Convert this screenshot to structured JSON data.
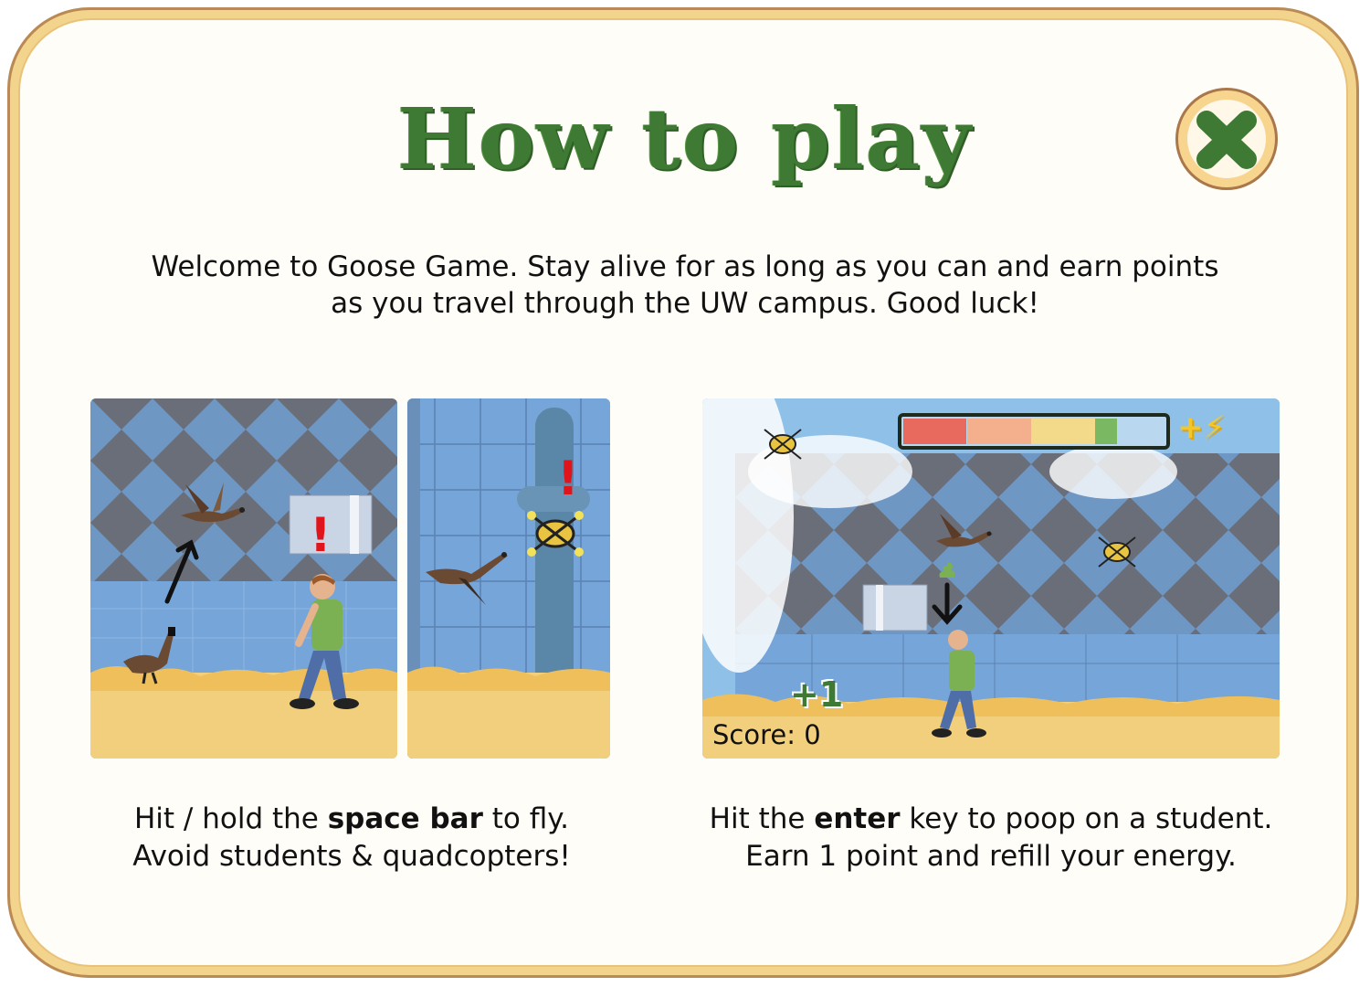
{
  "title": "How to play",
  "close_icon": "x-icon",
  "intro": {
    "line1": "Welcome to Goose Game. Stay alive for as long as you can and earn points",
    "line2": "as you travel through the UW campus. Good luck!"
  },
  "scene_fly": {
    "exclaim": "!",
    "caption": {
      "line1_pre": "Hit / hold the ",
      "line1_bold": "space bar",
      "line1_post": " to fly.",
      "line2": "Avoid students & quadcopters!"
    }
  },
  "scene_poop": {
    "energy_refill": "+⚡",
    "energy_level": 0.81,
    "plus_one": "+1",
    "score": "Score: 0",
    "caption": {
      "line1_pre": "Hit the ",
      "line1_bold": "enter",
      "line1_post": " key to poop on a student.",
      "line2": "Earn 1 point and refill your energy."
    }
  },
  "colors": {
    "title_green": "#3e7a33",
    "frame_tan": "#f3d48c",
    "grass": "#f2cf7c",
    "building_blue": "#6f97c4",
    "alert_red": "#e0141b"
  }
}
